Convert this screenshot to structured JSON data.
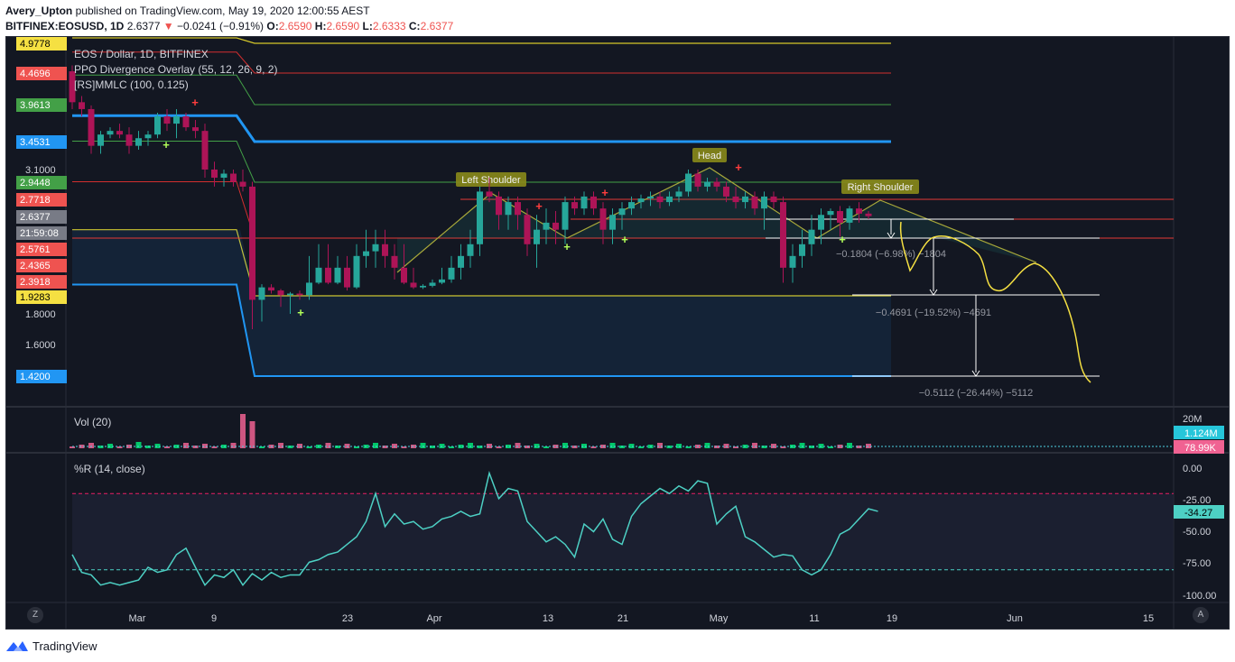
{
  "header": {
    "author": "Avery_Upton",
    "published_text": "published on TradingView.com, May 19, 2020 12:00:55 AEST",
    "symbol": "BITFINEX:EOSUSD, 1D",
    "last": "2.6377",
    "arrow": "▼",
    "change": "−0.0241 (−0.91%)",
    "o_label": "O:",
    "o": "2.6590",
    "h_label": "H:",
    "h": "2.6590",
    "l_label": "L:",
    "l": "2.6333",
    "c_label": "C:",
    "c": "2.6377"
  },
  "legend": {
    "title": "EOS / Dollar, 1D, BITFINEX",
    "ind1": "PPO Divergence Overlay (55, 12, 26, 9, 2)",
    "ind2": "[RS]MMLC (100, 0.125)"
  },
  "volume": {
    "label": "Vol (20)",
    "axis_top": "20M",
    "badge1": "1.124M",
    "badge2": "78.99K"
  },
  "wr": {
    "label": "%R (14, close)",
    "current": "-34.27"
  },
  "footer": {
    "brand": "TradingView"
  },
  "buttons": {
    "z": "Z",
    "a": "A"
  },
  "colors": {
    "bg": "#131722",
    "up": "#26a69a",
    "down": "#ad1457",
    "blue": "#2196f3",
    "yellow": "#d4c72a",
    "red": "#d32f2f",
    "green": "#43a047",
    "wr_line": "#4dd0c4"
  },
  "chart_data": {
    "type": "candlestick",
    "price_axis_ticks": [
      "3.1000",
      "1.8000",
      "1.6000"
    ],
    "price_badges": [
      {
        "text": "4.9778",
        "bg": "#f5e042",
        "fg": "#000000"
      },
      {
        "text": "4.4696",
        "bg": "#ef5350",
        "fg": "#ffffff"
      },
      {
        "text": "3.9613",
        "bg": "#43a047",
        "fg": "#ffffff"
      },
      {
        "text": "3.4531",
        "bg": "#2196f3",
        "fg": "#ffffff"
      },
      {
        "text": "2.9448",
        "bg": "#43a047",
        "fg": "#ffffff"
      },
      {
        "text": "2.7718",
        "bg": "#ef5350",
        "fg": "#ffffff"
      },
      {
        "text": "2.6377",
        "bg": "#787b86",
        "fg": "#ffffff"
      },
      {
        "text": "21:59:08",
        "bg": "#787b86",
        "fg": "#ffffff"
      },
      {
        "text": "2.5761",
        "bg": "#ef5350",
        "fg": "#ffffff"
      },
      {
        "text": "2.4365",
        "bg": "#ef5350",
        "fg": "#ffffff"
      },
      {
        "text": "2.3918",
        "bg": "#ef5350",
        "fg": "#ffffff"
      },
      {
        "text": "1.9283",
        "bg": "#f5e042",
        "fg": "#000000"
      },
      {
        "text": "1.4200",
        "bg": "#2196f3",
        "fg": "#ffffff"
      }
    ],
    "x_ticks": [
      "Mar",
      "9",
      "23",
      "Apr",
      "13",
      "21",
      "May",
      "11",
      "19",
      "Jun",
      "15"
    ],
    "annotations": {
      "left_shoulder": "Left Shoulder",
      "head": "Head",
      "right_shoulder": "Right Shoulder",
      "measure1": "−0.1804 (−6.98%) −1804",
      "measure2": "−0.4691 (−19.52%) −4691",
      "measure3": "−0.5112 (−26.44%) −5112"
    },
    "candles_approx": [
      [
        4.5,
        4.6,
        3.9,
        4.0
      ],
      [
        4.0,
        4.1,
        3.8,
        3.9
      ],
      [
        3.9,
        3.95,
        3.3,
        3.4
      ],
      [
        3.4,
        3.6,
        3.3,
        3.55
      ],
      [
        3.55,
        3.65,
        3.5,
        3.6
      ],
      [
        3.6,
        3.7,
        3.5,
        3.55
      ],
      [
        3.55,
        3.65,
        3.3,
        3.4
      ],
      [
        3.4,
        3.6,
        3.35,
        3.5
      ],
      [
        3.5,
        3.6,
        3.4,
        3.55
      ],
      [
        3.55,
        3.85,
        3.5,
        3.8
      ],
      [
        3.8,
        3.9,
        3.6,
        3.7
      ],
      [
        3.7,
        3.9,
        3.5,
        3.8
      ],
      [
        3.8,
        3.85,
        3.6,
        3.65
      ],
      [
        3.65,
        3.75,
        3.5,
        3.6
      ],
      [
        3.6,
        3.7,
        3.0,
        3.1
      ],
      [
        3.1,
        3.2,
        2.9,
        3.0
      ],
      [
        3.0,
        3.1,
        2.9,
        3.05
      ],
      [
        3.05,
        3.1,
        2.9,
        2.95
      ],
      [
        2.95,
        3.1,
        2.85,
        2.9
      ],
      [
        2.9,
        2.95,
        1.7,
        1.9
      ],
      [
        1.9,
        2.3,
        1.75,
        2.2
      ],
      [
        2.2,
        2.3,
        2.0,
        2.1
      ],
      [
        2.1,
        2.15,
        1.85,
        1.95
      ],
      [
        1.95,
        2.05,
        1.8,
        2.0
      ],
      [
        2.0,
        2.1,
        1.9,
        1.95
      ],
      [
        1.95,
        2.5,
        1.9,
        2.35
      ],
      [
        2.35,
        2.55,
        2.3,
        2.45
      ],
      [
        2.45,
        2.55,
        2.3,
        2.35
      ],
      [
        2.35,
        2.5,
        2.3,
        2.45
      ],
      [
        2.45,
        2.5,
        2.1,
        2.2
      ],
      [
        2.2,
        2.55,
        2.15,
        2.5
      ],
      [
        2.5,
        2.6,
        2.45,
        2.52
      ],
      [
        2.52,
        2.6,
        2.45,
        2.55
      ],
      [
        2.55,
        2.6,
        2.45,
        2.5
      ],
      [
        2.5,
        2.55,
        2.4,
        2.45
      ],
      [
        2.45,
        2.55,
        2.3,
        2.35
      ],
      [
        2.35,
        2.45,
        2.15,
        2.2
      ],
      [
        2.2,
        2.3,
        2.15,
        2.25
      ],
      [
        2.25,
        2.4,
        2.2,
        2.35
      ],
      [
        2.35,
        2.45,
        2.3,
        2.4
      ],
      [
        2.4,
        2.5,
        2.35,
        2.45
      ],
      [
        2.45,
        2.55,
        2.4,
        2.5
      ],
      [
        2.5,
        2.6,
        2.45,
        2.55
      ],
      [
        2.55,
        2.9,
        2.5,
        2.85
      ],
      [
        2.85,
        3.0,
        2.75,
        2.8
      ],
      [
        2.8,
        2.85,
        2.6,
        2.65
      ],
      [
        2.65,
        2.8,
        2.6,
        2.75
      ],
      [
        2.75,
        2.8,
        2.6,
        2.65
      ],
      [
        2.65,
        2.7,
        2.5,
        2.55
      ],
      [
        2.55,
        2.65,
        2.45,
        2.6
      ],
      [
        2.6,
        2.7,
        2.55,
        2.62
      ],
      [
        2.62,
        2.68,
        2.55,
        2.6
      ],
      [
        2.6,
        2.8,
        2.55,
        2.75
      ],
      [
        2.75,
        2.8,
        2.65,
        2.7
      ],
      [
        2.7,
        2.85,
        2.65,
        2.8
      ],
      [
        2.8,
        2.85,
        2.65,
        2.7
      ],
      [
        2.7,
        2.75,
        2.55,
        2.6
      ],
      [
        2.6,
        2.7,
        2.55,
        2.65
      ],
      [
        2.65,
        2.75,
        2.6,
        2.7
      ],
      [
        2.7,
        2.8,
        2.65,
        2.75
      ],
      [
        2.75,
        2.82,
        2.7,
        2.78
      ],
      [
        2.78,
        2.85,
        2.72,
        2.8
      ],
      [
        2.8,
        2.85,
        2.7,
        2.75
      ],
      [
        2.75,
        2.85,
        2.72,
        2.8
      ],
      [
        2.8,
        2.9,
        2.75,
        2.85
      ],
      [
        2.85,
        3.1,
        2.8,
        3.05
      ],
      [
        3.05,
        3.1,
        2.85,
        2.9
      ],
      [
        2.9,
        3.0,
        2.85,
        2.95
      ],
      [
        2.95,
        3.0,
        2.85,
        2.9
      ],
      [
        2.9,
        2.95,
        2.75,
        2.8
      ],
      [
        2.8,
        2.9,
        2.7,
        2.75
      ],
      [
        2.75,
        2.85,
        2.7,
        2.8
      ],
      [
        2.8,
        2.85,
        2.65,
        2.7
      ],
      [
        2.7,
        2.85,
        2.6,
        2.8
      ],
      [
        2.8,
        2.85,
        2.7,
        2.75
      ],
      [
        2.75,
        2.8,
        2.35,
        2.45
      ],
      [
        2.45,
        2.55,
        2.35,
        2.5
      ],
      [
        2.5,
        2.6,
        2.45,
        2.55
      ],
      [
        2.55,
        2.65,
        2.5,
        2.6
      ],
      [
        2.6,
        2.7,
        2.55,
        2.65
      ],
      [
        2.65,
        2.7,
        2.6,
        2.68
      ],
      [
        2.68,
        2.72,
        2.58,
        2.62
      ],
      [
        2.62,
        2.72,
        2.6,
        2.7
      ],
      [
        2.7,
        2.75,
        2.62,
        2.66
      ],
      [
        2.66,
        2.68,
        2.63,
        2.64
      ]
    ],
    "wr_levels": [
      "0.00",
      "-25.00",
      "-50.00",
      "-75.00",
      "-100.00"
    ],
    "wr_values": [
      -68,
      -82,
      -84,
      -92,
      -90,
      -92,
      -90,
      -88,
      -78,
      -82,
      -80,
      -68,
      -63,
      -78,
      -92,
      -84,
      -86,
      -80,
      -92,
      -83,
      -88,
      -82,
      -86,
      -84,
      -84,
      -74,
      -72,
      -68,
      -66,
      -60,
      -54,
      -42,
      -20,
      -46,
      -36,
      -44,
      -42,
      -48,
      -46,
      -40,
      -38,
      -34,
      -38,
      -36,
      -4,
      -24,
      -16,
      -18,
      -42,
      -50,
      -58,
      -54,
      -60,
      -70,
      -44,
      -50,
      -40,
      -56,
      -60,
      -38,
      -28,
      -22,
      -16,
      -20,
      -14,
      -18,
      -10,
      -12,
      -44,
      -36,
      -30,
      -54,
      -58,
      -64,
      -70,
      -68,
      -69,
      -80,
      -84,
      -80,
      -68,
      -52,
      -48,
      -40,
      -32,
      -34
    ]
  }
}
